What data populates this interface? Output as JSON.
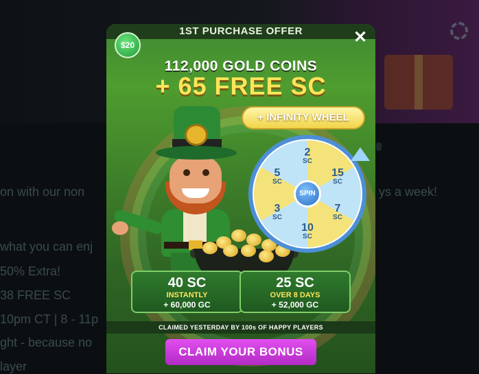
{
  "background": {
    "lines": [
      "on with our non",
      "what you can enj",
      "50% Extra!",
      " 38 FREE SC",
      "10pm CT | 8 - 11p",
      "ght - because no",
      "layer"
    ],
    "right_fragment": "ys a week!"
  },
  "modal": {
    "title": "1ST PURCHASE OFFER",
    "close_symbol": "✕",
    "price_badge": "$20",
    "headline_coins": "112,000 GOLD COINS",
    "headline_sc": "+ 65 FREE SC",
    "infinity_label": "+ INFINITY WHEEL",
    "wheel": {
      "hub_label": "SPIN",
      "segments": [
        {
          "value": "2",
          "unit": "SC"
        },
        {
          "value": "15",
          "unit": "SC"
        },
        {
          "value": "7",
          "unit": "SC"
        },
        {
          "value": "10",
          "unit": "SC"
        },
        {
          "value": "3",
          "unit": "SC"
        },
        {
          "value": "5",
          "unit": "SC"
        }
      ],
      "colors": {
        "yellow": "#f4e27a",
        "blue": "#bfe3f7",
        "border": "#4d8fd6"
      }
    },
    "cards": {
      "left": {
        "amount": "40 SC",
        "timing": "INSTANTLY",
        "gc": "+ 60,000 GC"
      },
      "right": {
        "amount": "25 SC",
        "timing": "OVER 8 DAYS",
        "gc": "+ 52,000 GC"
      }
    },
    "social_proof": "CLAIMED YESTERDAY BY 100s OF HAPPY PLAYERS",
    "cta_label": "CLAIM YOUR BONUS"
  },
  "colors": {
    "accent_gold": "#ffe45a",
    "cta": "#c23ad8",
    "modal_green": "#3f8a33"
  }
}
